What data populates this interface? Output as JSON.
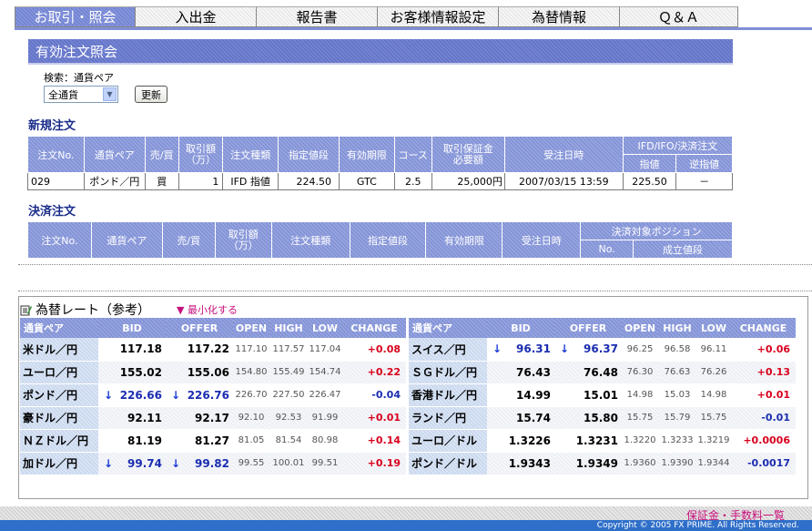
{
  "nav": {
    "tabs": [
      "お取引・照会",
      "入出金",
      "報告書",
      "お客様情報設定",
      "為替情報",
      "Ｑ＆Ａ"
    ]
  },
  "page_title": "有効注文照会",
  "search": {
    "label": "検索：通貨ペア",
    "selected": "全通貨",
    "button": "更新"
  },
  "new_orders": {
    "heading": "新規注文",
    "headers": [
      "注文No.",
      "通貨ペア",
      "売/買",
      "取引額\n（万）",
      "注文種類",
      "指定値段",
      "有効期限",
      "コース",
      "取引保証金\n必要額",
      "受注日時",
      "IFD/IFO/決済注文",
      "指値",
      "逆指値"
    ],
    "rows": [
      [
        "029",
        "ポンド／円",
        "買",
        "1",
        "IFD 指値",
        "224.50",
        "GTC",
        "2.5",
        "25,000円",
        "2007/03/15 13:59",
        "225.50",
        "－"
      ]
    ]
  },
  "close_orders": {
    "heading": "決済注文",
    "headers": [
      "注文No.",
      "通貨ペア",
      "売/買",
      "取引額\n（万）",
      "注文種類",
      "指定値段",
      "有効期限",
      "受注日時",
      "決済対象ポジション",
      "No.",
      "成立値段"
    ]
  },
  "rates": {
    "title": "為替レート（参考）",
    "minimize": "▼ 最小化する",
    "headers": [
      "通貨ペア",
      "BID",
      "OFFER",
      "OPEN",
      "HIGH",
      "LOW",
      "CHANGE"
    ],
    "left": [
      {
        "pair": "米ドル／円",
        "bid": "117.18",
        "offer": "117.22",
        "open": "117.10",
        "high": "117.57",
        "low": "117.04",
        "change": "+0.08",
        "down": false
      },
      {
        "pair": "ユーロ／円",
        "bid": "155.02",
        "offer": "155.06",
        "open": "154.80",
        "high": "155.49",
        "low": "154.74",
        "change": "+0.22",
        "down": false
      },
      {
        "pair": "ポンド／円",
        "bid": "226.66",
        "offer": "226.76",
        "open": "226.70",
        "high": "227.50",
        "low": "226.47",
        "change": "-0.04",
        "down": true
      },
      {
        "pair": "豪ドル／円",
        "bid": "92.11",
        "offer": "92.17",
        "open": "92.10",
        "high": "92.53",
        "low": "91.99",
        "change": "+0.01",
        "down": false
      },
      {
        "pair": "ＮＺドル／円",
        "bid": "81.19",
        "offer": "81.27",
        "open": "81.05",
        "high": "81.54",
        "low": "80.98",
        "change": "+0.14",
        "down": false
      },
      {
        "pair": "加ドル／円",
        "bid": "99.74",
        "offer": "99.82",
        "open": "99.55",
        "high": "100.01",
        "low": "99.51",
        "change": "+0.19",
        "down": true
      }
    ],
    "right": [
      {
        "pair": "スイス／円",
        "bid": "96.31",
        "offer": "96.37",
        "open": "96.25",
        "high": "96.58",
        "low": "96.11",
        "change": "+0.06",
        "down": true
      },
      {
        "pair": "ＳＧドル／円",
        "bid": "76.43",
        "offer": "76.48",
        "open": "76.30",
        "high": "76.63",
        "low": "76.26",
        "change": "+0.13",
        "down": false
      },
      {
        "pair": "香港ドル／円",
        "bid": "14.99",
        "offer": "15.01",
        "open": "14.98",
        "high": "15.03",
        "low": "14.98",
        "change": "+0.01",
        "down": false
      },
      {
        "pair": "ランド／円",
        "bid": "15.74",
        "offer": "15.80",
        "open": "15.75",
        "high": "15.79",
        "low": "15.75",
        "change": "-0.01",
        "down": false
      },
      {
        "pair": "ユーロ／ドル",
        "bid": "1.3226",
        "offer": "1.3231",
        "open": "1.3220",
        "high": "1.3233",
        "low": "1.3219",
        "change": "+0.0006",
        "down": false
      },
      {
        "pair": "ポンド／ドル",
        "bid": "1.9343",
        "offer": "1.9349",
        "open": "1.9360",
        "high": "1.9390",
        "low": "1.9344",
        "change": "-0.0017",
        "down": false
      }
    ],
    "colors": {
      "up": "#d8001c",
      "down": "#1a2db0",
      "arrow": "#1a3bd6"
    }
  },
  "footer": {
    "link": "保証金・手数料一覧",
    "copyright": "Copyright © 2005 FX PRIME. All Rights Reserved."
  }
}
